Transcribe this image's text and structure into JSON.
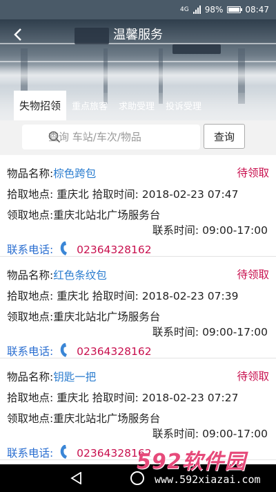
{
  "status_bar": {
    "network": "4G",
    "battery": "98%",
    "time": "08:47",
    "battery_level": 0.98
  },
  "header": {
    "title": "温馨服务"
  },
  "tabs": [
    {
      "label": "失物招领",
      "active": true
    },
    {
      "label": "重点旅客",
      "active": false
    },
    {
      "label": "求助受理",
      "active": false
    },
    {
      "label": "投诉受理",
      "active": false
    }
  ],
  "search": {
    "placeholder": "查询 车站/车次/物品",
    "button_label": "查询"
  },
  "labels": {
    "item_name": "物品名称:",
    "pickup_place": "拾取地点:",
    "pickup_time": "拾取时间:",
    "claim_place": "领取地点:",
    "contact_time": "联系时间:",
    "contact_phone": "联系电话:"
  },
  "items": [
    {
      "name": "棕色跨包",
      "status": "待领取",
      "pickup_place": "重庆北",
      "pickup_time": "2018-02-23 07:47",
      "claim_place": "重庆北站北广场服务台",
      "contact_time": "09:00-17:00",
      "phone": "02364328162"
    },
    {
      "name": "红色条纹包",
      "status": "待领取",
      "pickup_place": "重庆北",
      "pickup_time": "2018-02-23 07:39",
      "claim_place": "重庆北站北广场服务台",
      "contact_time": "09:00-17:00",
      "phone": "02364328162"
    },
    {
      "name": "钥匙一把",
      "status": "待领取",
      "pickup_place": "重庆北",
      "pickup_time": "2018-02-23 07:27",
      "claim_place": "重庆北站北广场服务台",
      "contact_time": "09:00-17:00",
      "phone": "02364328162"
    }
  ],
  "watermark": {
    "brand": "592软件园",
    "url": "www.592xiazai.com"
  },
  "colors": {
    "status": "#c8104e",
    "link_blue": "#2a7ccf",
    "phone_label": "#2a6ed0",
    "status_bar": "#4a5a68"
  }
}
